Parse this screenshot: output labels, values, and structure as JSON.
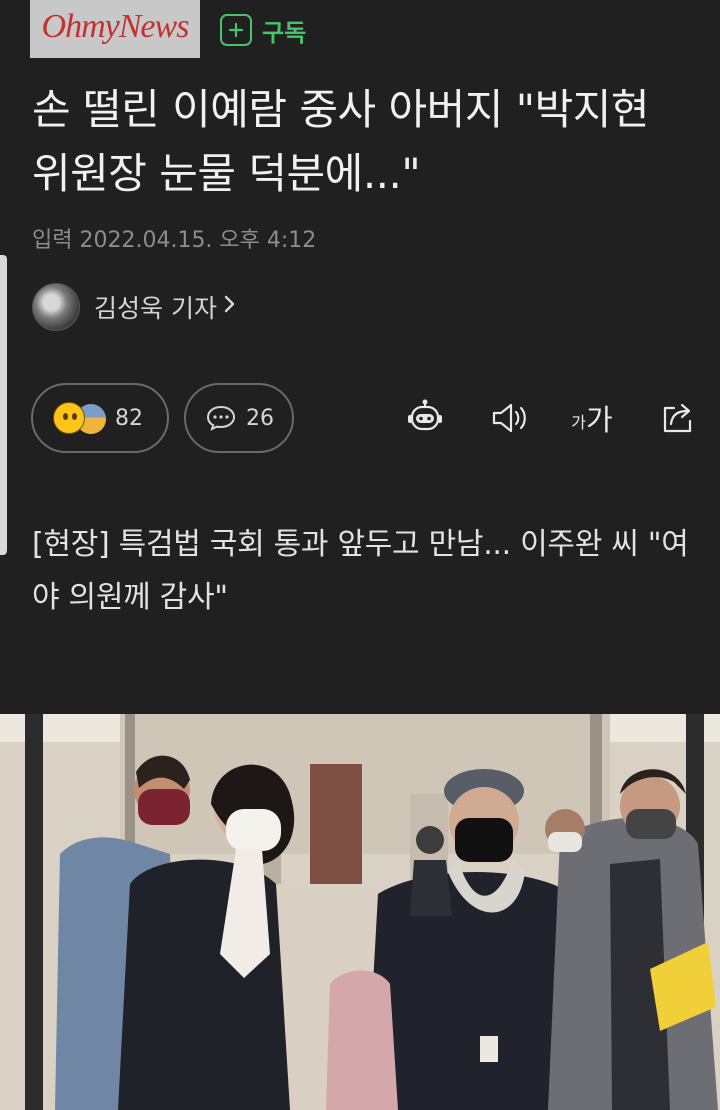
{
  "header": {
    "logo_text": "OhmyNews",
    "subscribe_label": "구독",
    "subscribe_icon": "plus-icon"
  },
  "article": {
    "title": "손 떨린 이예람 중사 아버지 \"박지현 위원장 눈물 덕분에...\"",
    "dateline": "입력 2022.04.15. 오후 4:12",
    "reporter_name": "김성욱 기자",
    "reactions_count": "82",
    "comments_count": "26",
    "font_small": "가",
    "font_big": "가",
    "subtitle": "[현장] 특검법 국회 통과 앞두고 만남... 이주완 씨 \"여야 의원께 감사\""
  },
  "colors": {
    "background": "#202020",
    "accent_green": "#45c46a",
    "logo_red": "#c4312f"
  },
  "icons": {
    "reporter_chevron": "chevron-right-icon",
    "comment": "comment-icon",
    "summary": "robot-icon",
    "listen": "speaker-icon",
    "font_size": "font-size-icon",
    "share": "share-icon"
  }
}
